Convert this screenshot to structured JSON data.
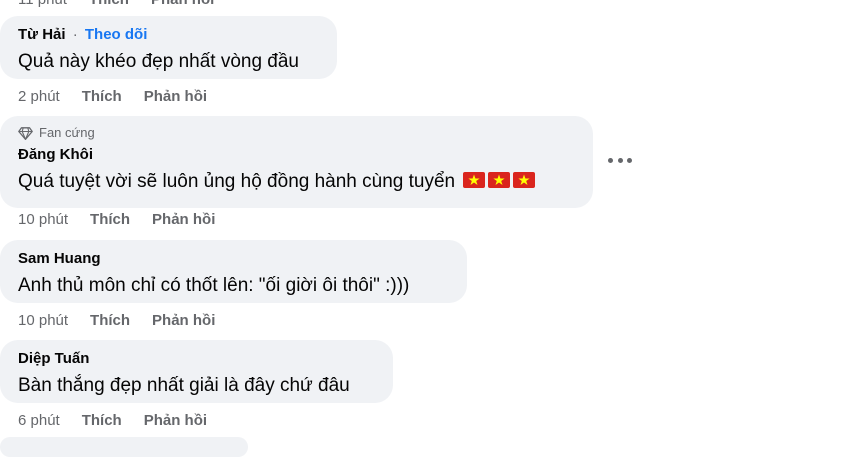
{
  "top": {
    "time": "11 phút",
    "like": "Thích",
    "reply": "Phản hồi"
  },
  "comments": [
    {
      "author": "Từ Hải",
      "separator": "·",
      "follow": "Theo dõi",
      "text": "Quả này khéo đẹp nhất vòng đầu",
      "time": "2 phút",
      "like": "Thích",
      "reply": "Phản hồi"
    },
    {
      "badge": "Fan cứng",
      "author": "Đăng Khôi",
      "text": "Quá tuyệt vời sẽ luôn ủng hộ đồng hành cùng tuyển",
      "emoji": [
        "vietnam-flag",
        "vietnam-flag",
        "vietnam-flag"
      ],
      "time": "10 phút",
      "like": "Thích",
      "reply": "Phản hồi"
    },
    {
      "author": "Sam Huang",
      "text": "Anh thủ môn chỉ có thốt lên: \"ối giời ôi thôi\" :)))",
      "time": "10 phút",
      "like": "Thích",
      "reply": "Phản hồi"
    },
    {
      "author": "Diệp Tuấn",
      "text": "Bàn thắng đẹp nhất giải là đây chứ đâu",
      "time": "6 phút",
      "like": "Thích",
      "reply": "Phản hồi"
    }
  ],
  "colors": {
    "bubble": "#f0f2f5",
    "secondary_text": "#65676b",
    "link": "#1877f2",
    "flag_red": "#da251d",
    "flag_star": "#ffff00"
  }
}
